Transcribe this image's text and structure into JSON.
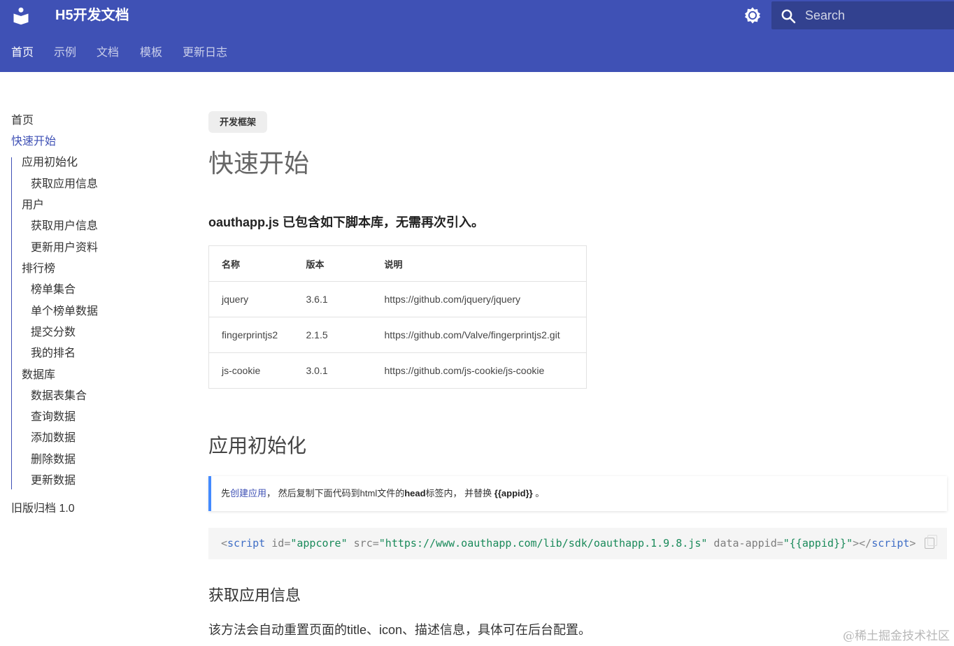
{
  "header": {
    "title": "H5开发文档",
    "logo_icon": "book-reader-icon",
    "theme_icon": "brightness-icon",
    "search_placeholder": "Search",
    "tabs": [
      {
        "label": "首页",
        "active": true
      },
      {
        "label": "示例",
        "active": false
      },
      {
        "label": "文档",
        "active": false
      },
      {
        "label": "模板",
        "active": false
      },
      {
        "label": "更新日志",
        "active": false
      }
    ]
  },
  "sidebar": {
    "items": [
      {
        "label": "首页",
        "level": 0
      },
      {
        "label": "快速开始",
        "level": 0,
        "active": true
      },
      {
        "label": "应用初始化",
        "level": 1
      },
      {
        "label": "获取应用信息",
        "level": 2
      },
      {
        "label": "用户",
        "level": 1
      },
      {
        "label": "获取用户信息",
        "level": 2
      },
      {
        "label": "更新用户资料",
        "level": 2
      },
      {
        "label": "排行榜",
        "level": 1
      },
      {
        "label": "榜单集合",
        "level": 2
      },
      {
        "label": "单个榜单数据",
        "level": 2
      },
      {
        "label": "提交分数",
        "level": 2
      },
      {
        "label": "我的排名",
        "level": 2
      },
      {
        "label": "数据库",
        "level": 1
      },
      {
        "label": "数据表集合",
        "level": 2
      },
      {
        "label": "查询数据",
        "level": 2
      },
      {
        "label": "添加数据",
        "level": 2
      },
      {
        "label": "删除数据",
        "level": 2
      },
      {
        "label": "更新数据",
        "level": 2
      },
      {
        "label": "旧版归档 1.0",
        "level": 0
      }
    ]
  },
  "content": {
    "chip": "开发框架",
    "title": "快速开始",
    "lead": "oauthapp.js 已包含如下脚本库，无需再次引入。",
    "table": {
      "headers": [
        "名称",
        "版本",
        "说明"
      ],
      "rows": [
        [
          "jquery",
          "3.6.1",
          "https://github.com/jquery/jquery"
        ],
        [
          "fingerprintjs2",
          "2.1.5",
          "https://github.com/Valve/fingerprintjs2.git"
        ],
        [
          "js-cookie",
          "3.0.1",
          "https://github.com/js-cookie/js-cookie"
        ]
      ]
    },
    "section_title": "应用初始化",
    "note": {
      "prefix": "先",
      "link": "创建应用",
      "middle": "， 然后复制下面代码到html文件的",
      "bold": "head",
      "after": "标签内， 并替换 ",
      "placeholder": "{{appid}}",
      "end": " 。"
    },
    "code": {
      "open_tag": "script",
      "attr1": "id",
      "val1": "\"appcore\"",
      "attr2": "src",
      "val2": "\"https://www.oauthapp.com/lib/sdk/oauthapp.1.9.8.js\"",
      "attr3": "data-appid",
      "val3": "\"{{appid}}\"",
      "close_tag": "script"
    },
    "subsection_title": "获取应用信息",
    "paragraph": "该方法会自动重置页面的title、icon、描述信息，具体可在后台配置。"
  },
  "watermark": "@稀土掘金技术社区",
  "colors": {
    "primary": "#3f51b5",
    "search_bg": "#32418f",
    "note_border": "#448aff"
  }
}
